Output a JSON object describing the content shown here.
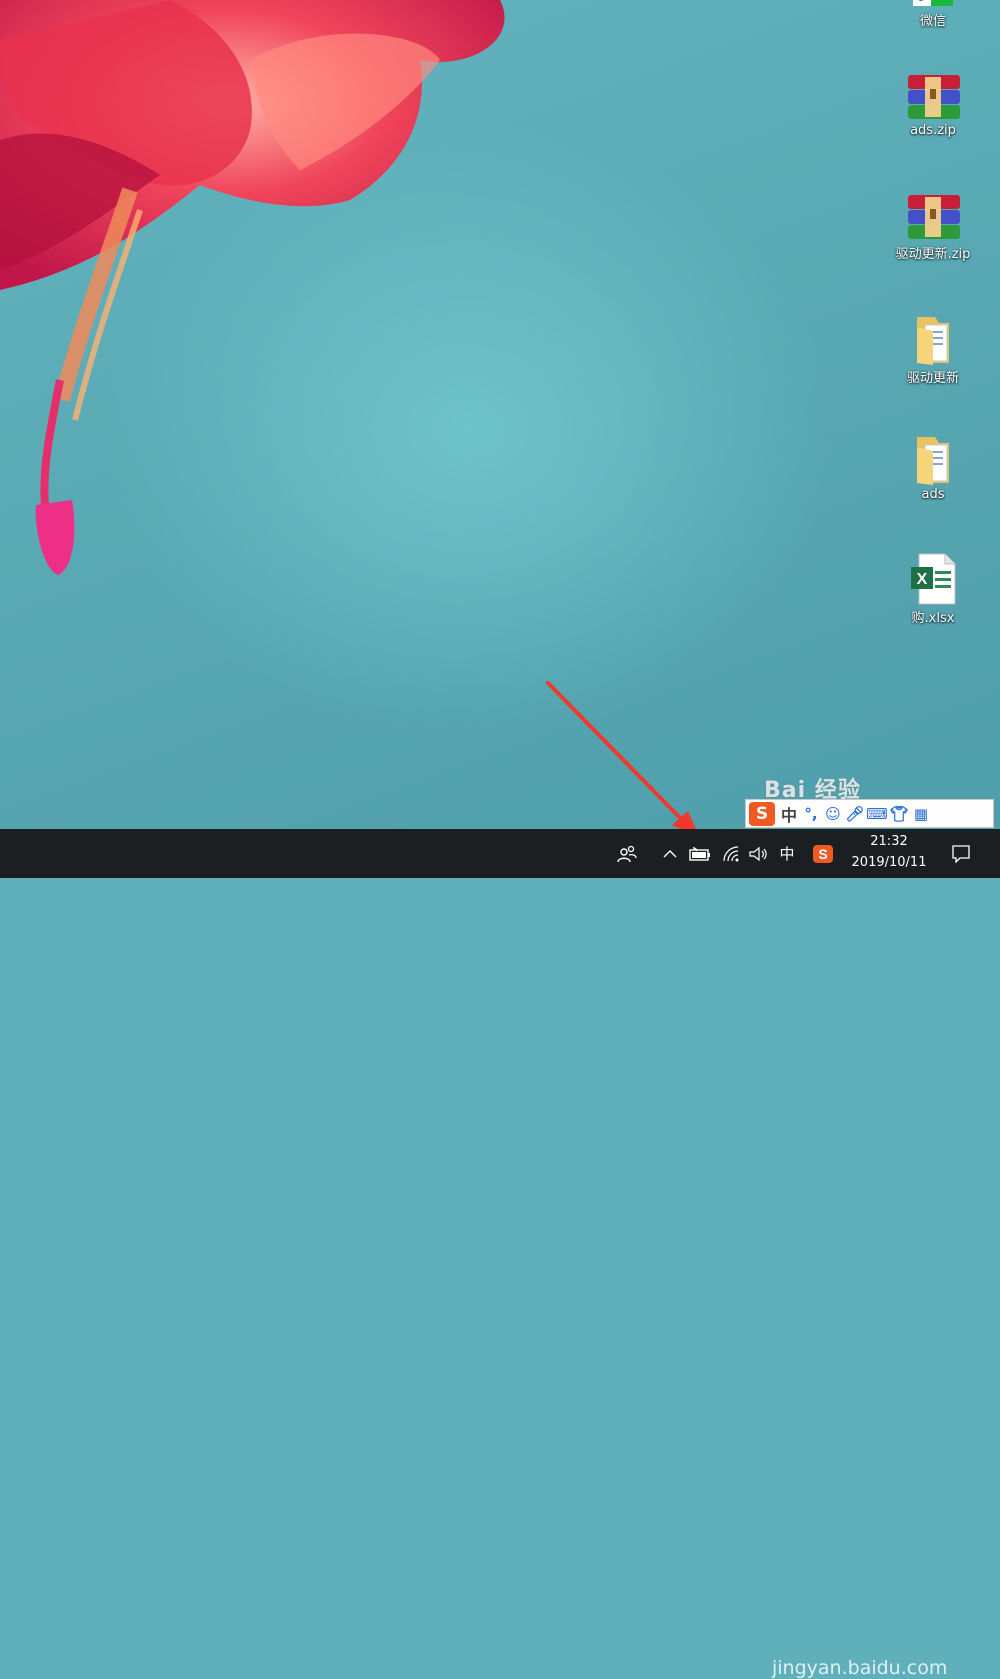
{
  "desktop": {
    "icons": [
      {
        "label": "微信",
        "icon": "wechat-icon"
      },
      {
        "label": "ads.zip",
        "icon": "winrar-archive-icon"
      },
      {
        "label": "驱动更新.zip",
        "icon": "winrar-archive-icon"
      },
      {
        "label": "驱动更新",
        "icon": "folder-icon"
      },
      {
        "label": "ads",
        "icon": "folder-icon"
      },
      {
        "label": "购.xlsx",
        "icon": "excel-file-icon"
      }
    ],
    "excel_letter": "X"
  },
  "annotation": {
    "arrow_color": "#f2382e"
  },
  "ime": {
    "logo": "S",
    "mode_label": "中"
  },
  "watermark": {
    "brand": "Bai 经验",
    "url": "jingyan.baidu.com"
  },
  "taskbar": {
    "tray": {
      "people": "people-icon",
      "expand": "chevron-up-icon",
      "battery": "battery-charging-icon",
      "wifi": "wifi-icon",
      "volume": "volume-icon",
      "input_language": "中",
      "ime": "sogou-ime-icon",
      "action_center": "notification-icon"
    },
    "clock": {
      "time": "21:32",
      "date": "2019/10/11"
    }
  }
}
